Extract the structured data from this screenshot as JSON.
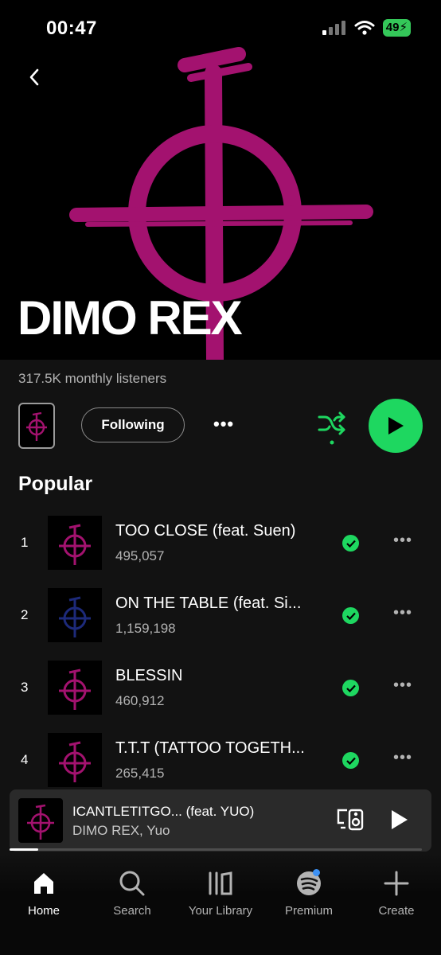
{
  "status_bar": {
    "time": "00:47",
    "battery": "49"
  },
  "artist": {
    "name": "DIMO REX",
    "monthly_listeners": "317.5K monthly listeners",
    "follow_label": "Following",
    "more_label": "•••"
  },
  "popular": {
    "heading": "Popular",
    "tracks": [
      {
        "num": "1",
        "title": "TOO CLOSE (feat. Suen)",
        "plays": "495,057",
        "more": "•••"
      },
      {
        "num": "2",
        "title": "ON THE TABLE (feat. Si...",
        "plays": "1,159,198",
        "more": "•••"
      },
      {
        "num": "3",
        "title": "BLESSIN",
        "plays": "460,912",
        "more": "•••"
      },
      {
        "num": "4",
        "title": "T.T.T (TATTOO TOGETH...",
        "plays": "265,415",
        "more": "•••"
      }
    ]
  },
  "now_playing": {
    "title": "ICANTLETITGO... (feat. YUO)",
    "artists": "DIMO REX, Yuo",
    "progress": 0.07
  },
  "nav": {
    "items": [
      {
        "label": "Home",
        "icon": "home-icon"
      },
      {
        "label": "Search",
        "icon": "search-icon"
      },
      {
        "label": "Your Library",
        "icon": "library-icon"
      },
      {
        "label": "Premium",
        "icon": "spotify-icon"
      },
      {
        "label": "Create",
        "icon": "plus-icon"
      }
    ]
  },
  "colors": {
    "accent": "#1ed760",
    "art_magenta": "#a3126f",
    "art_blue": "#1d2a7a",
    "background": "#121212"
  }
}
